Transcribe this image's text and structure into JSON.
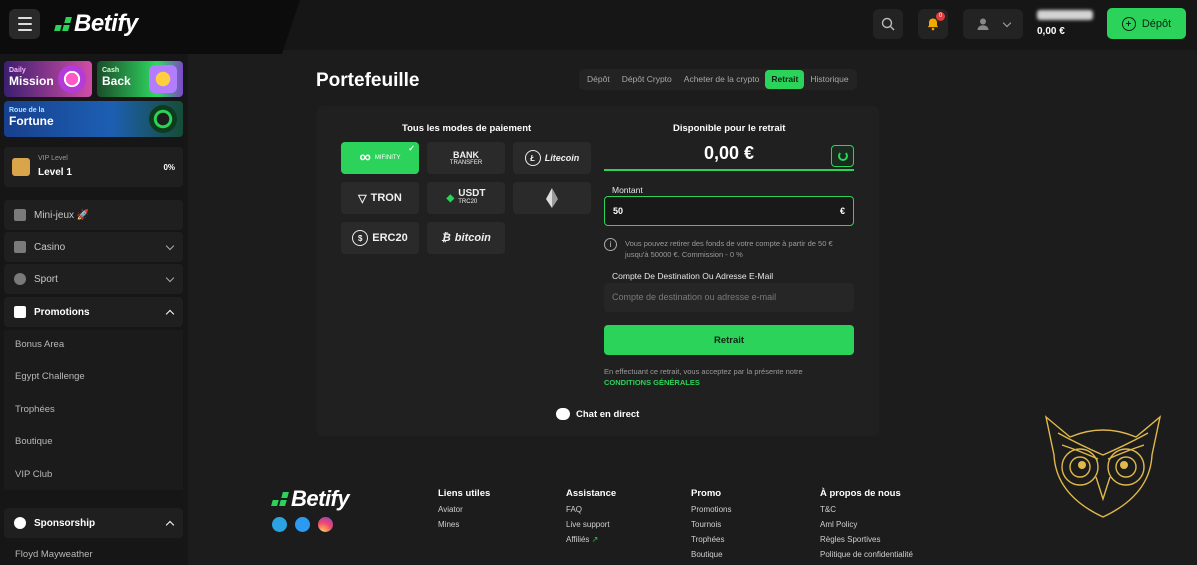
{
  "header": {
    "logo_text": "Betify",
    "notification_count": "0",
    "balance_amount": "0,00 €",
    "deposit_label": "Dépôt"
  },
  "sidebar": {
    "promo_cards": [
      {
        "line1": "Daily",
        "line2": "Mission"
      },
      {
        "line1": "Cash",
        "line2": "Back"
      },
      {
        "line1": "Roue de la",
        "line2": "Fortune"
      }
    ],
    "vip": {
      "caption": "VIP Level",
      "level": "Level 1",
      "percent": "0%"
    },
    "nav": [
      {
        "label": "Mini-jeux 🚀"
      },
      {
        "label": "Casino"
      },
      {
        "label": "Sport"
      },
      {
        "label": "Promotions"
      }
    ],
    "promotions_items": [
      "Bonus Area",
      "Egypt Challenge",
      "Trophées",
      "Boutique",
      "VIP Club"
    ],
    "sponsorship": {
      "label": "Sponsorship",
      "items": [
        "Floyd Mayweather"
      ]
    }
  },
  "main": {
    "title": "Portefeuille",
    "tabs": [
      {
        "label": "Dépôt",
        "active": false
      },
      {
        "label": "Dépôt Crypto",
        "active": false
      },
      {
        "label": "Acheter de la crypto",
        "active": false
      },
      {
        "label": "Retrait",
        "active": true
      },
      {
        "label": "Historique",
        "active": false
      }
    ],
    "methods_title": "Tous les modes de paiement",
    "methods": [
      {
        "name": "MIFINITY",
        "selected": true
      },
      {
        "name": "BANK",
        "sub": "TRANSFER"
      },
      {
        "name": "Litecoin"
      },
      {
        "name": "TRON"
      },
      {
        "name": "USDT",
        "sub": "TRC20"
      },
      {
        "name": "Ethereum"
      },
      {
        "name": "ERC20"
      },
      {
        "name": "bitcoin"
      }
    ],
    "available_title": "Disponible pour le retrait",
    "available_amount": "0,00 €",
    "amount_label": "Montant",
    "amount_value": "50",
    "amount_currency": "€",
    "info_text": "Vous pouvez retirer des fonds de votre compte à partir de 50 € jusqu'à 50000 €. Commission - 0 %",
    "destination_label": "Compte De Destination Ou Adresse E-Mail",
    "destination_placeholder": "Compte de destination ou adresse e-mail",
    "withdraw_label": "Retrait",
    "terms_text": "En effectuant ce retrait, vous acceptez par la présente notre",
    "terms_link": "CONDITIONS GÉNÉRALES",
    "chat_label": "Chat en direct"
  },
  "footer": {
    "logo_text": "Betify",
    "columns": [
      {
        "title": "Liens utiles",
        "links": [
          "Aviator",
          "Mines"
        ]
      },
      {
        "title": "Assistance",
        "links": [
          "FAQ",
          "Live support",
          "Affiliés"
        ]
      },
      {
        "title": "Promo",
        "links": [
          "Promotions",
          "Tournois",
          "Trophées",
          "Boutique"
        ]
      },
      {
        "title": "À propos de nous",
        "links": [
          "T&C",
          "Aml Policy",
          "Règles Sportives",
          "Politique de confidentialité"
        ]
      }
    ]
  },
  "colors": {
    "accent": "#2bd35a",
    "background": "#1c1c1c",
    "panel": "#202020"
  }
}
